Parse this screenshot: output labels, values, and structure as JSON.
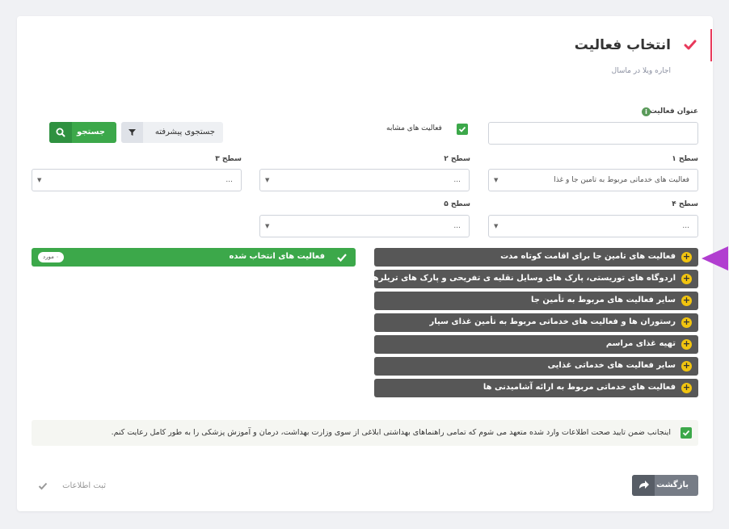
{
  "header": {
    "title": "انتخاب فعالیت",
    "subtitle": "اجاره ویلا در ماسال",
    "accent_color": "#e8395b"
  },
  "filters": {
    "activity_title_label": "عنوان فعالیت",
    "activity_title_value": "",
    "similar_activities_label": "فعالیت های مشابه",
    "similar_activities_checked": true,
    "advanced_search_label": "جستجوی پیشرفته",
    "search_label": "جستجو",
    "level1_label": "سطح ۱",
    "level1_value": "فعالیت های خدماتی مربوط به تامین جا و غذا",
    "level2_label": "سطح ۲",
    "level2_value": "...",
    "level3_label": "سطح ۳",
    "level3_value": "...",
    "level4_label": "سطح ۴",
    "level4_value": "...",
    "level5_label": "سطح ۵",
    "level5_value": "..."
  },
  "activities": [
    {
      "label": "فعالیت های تامین جا برای اقامت کوتاه مدت"
    },
    {
      "label": "اردوگاه های توریستی، پارک های وسایل نقلیه ی تفریحی و پارک های تریلرها"
    },
    {
      "label": "سایر فعالیت های مربوط به تأمین جا"
    },
    {
      "label": "رستوران ها و فعالیت های خدماتی مربوط به تأمین غذای سیار"
    },
    {
      "label": "تهیه غذای مراسم"
    },
    {
      "label": "سایر فعالیت های خدماتی غذایی"
    },
    {
      "label": "فعالیت های خدماتی مربوط به ارائه آشامیدنی ها"
    }
  ],
  "selected": {
    "title": "فعالیت های انتخاب شده",
    "badge": "۰ مورد"
  },
  "agreement": {
    "text": "اینجانب ضمن تایید صحت اطلاعات وارد شده متعهد می شوم که تمامی راهنماهای بهداشتی ابلاغی از سوی وزارت بهداشت، درمان و آموزش پزشکی را به طور کامل رعایت کنم.",
    "checked": true
  },
  "footer": {
    "back_label": "بازگشت",
    "submit_label": "ثبت اطلاعات"
  },
  "colors": {
    "green": "#3ca84a",
    "dark_item": "#575757",
    "plus_yellow": "#f1c40f",
    "pointer": "#b13ed0"
  }
}
